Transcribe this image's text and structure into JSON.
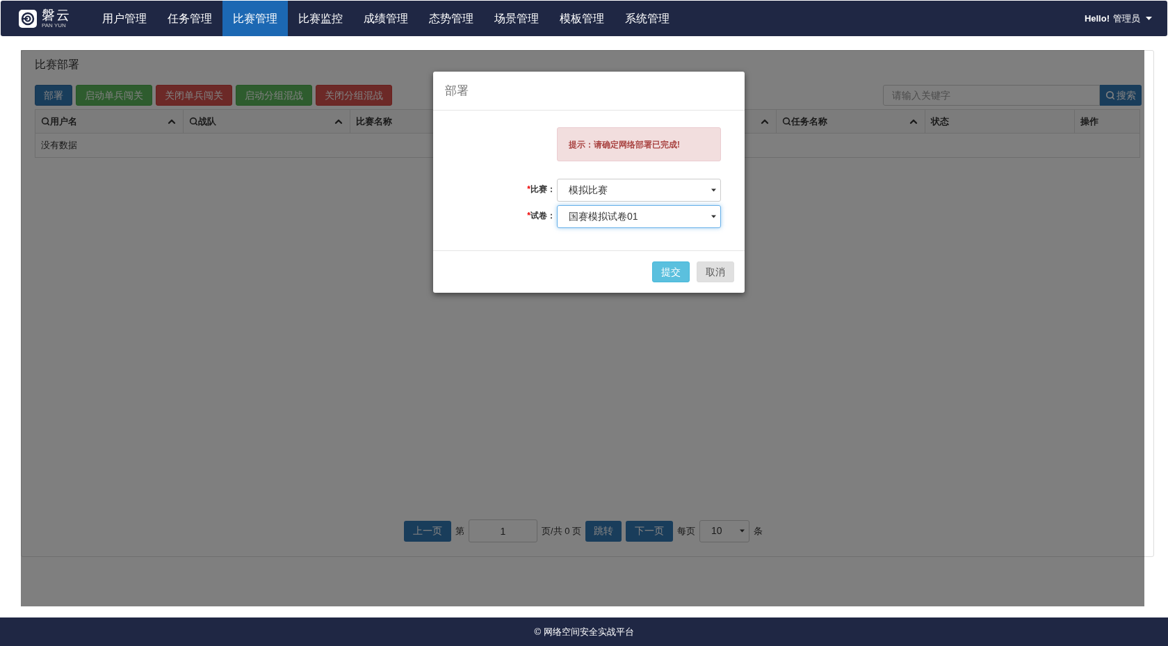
{
  "brand": {
    "name": "磐云",
    "subtitle": "PAN YUN"
  },
  "nav": [
    {
      "label": "用户管理",
      "selected": false
    },
    {
      "label": "任务管理",
      "selected": false
    },
    {
      "label": "比赛管理",
      "selected": true
    },
    {
      "label": "比赛监控",
      "selected": false
    },
    {
      "label": "成绩管理",
      "selected": false
    },
    {
      "label": "态势管理",
      "selected": false
    },
    {
      "label": "场景管理",
      "selected": false
    },
    {
      "label": "模板管理",
      "selected": false
    },
    {
      "label": "系统管理",
      "selected": false
    }
  ],
  "user_menu": {
    "greeting": "Hello!",
    "name": "管理员"
  },
  "panel": {
    "title": "比赛部署",
    "actions": [
      {
        "label": "部署",
        "kind": "primary"
      },
      {
        "label": "启动单兵闯关",
        "kind": "success"
      },
      {
        "label": "关闭单兵闯关",
        "kind": "danger"
      },
      {
        "label": "启动分组混战",
        "kind": "success"
      },
      {
        "label": "关闭分组混战",
        "kind": "danger"
      }
    ],
    "search": {
      "placeholder": "请输入关键字",
      "button": "搜索"
    },
    "table": {
      "columns": [
        {
          "label": "用户名",
          "searchable": true,
          "sortable": true
        },
        {
          "label": "战队",
          "searchable": true,
          "sortable": true
        },
        {
          "label": "比赛名称",
          "searchable": false
        },
        {
          "sortable": true
        },
        {
          "label": "任务名称",
          "searchable": true,
          "sortable": true
        },
        {
          "label": "状态",
          "searchable": false,
          "sortable": false
        },
        {
          "label": "操作",
          "searchable": false,
          "sortable": false
        }
      ],
      "empty_text": "没有数据"
    },
    "pagination": {
      "prev": "上一页",
      "page_prefix": "第",
      "page_value": "1",
      "page_suffix": "页/共 0 页",
      "jump": "跳转",
      "next": "下一页",
      "per_page_prefix": "每页",
      "per_page_value": "10",
      "per_page_suffix": "条"
    }
  },
  "dialog": {
    "title": "部署",
    "alert": "提示：请确定网络部署已完成!",
    "fields": [
      {
        "required_mark": "*",
        "label": "比赛：",
        "value": "模拟比赛",
        "focused": false
      },
      {
        "required_mark": "*",
        "label": "试卷：",
        "value": "国赛模拟试卷01",
        "focused": true
      }
    ],
    "buttons": [
      {
        "label": "提交",
        "kind": "info"
      },
      {
        "label": "取消",
        "kind": "default"
      }
    ]
  },
  "footer": {
    "text": "© 网络空间安全实战平台"
  }
}
